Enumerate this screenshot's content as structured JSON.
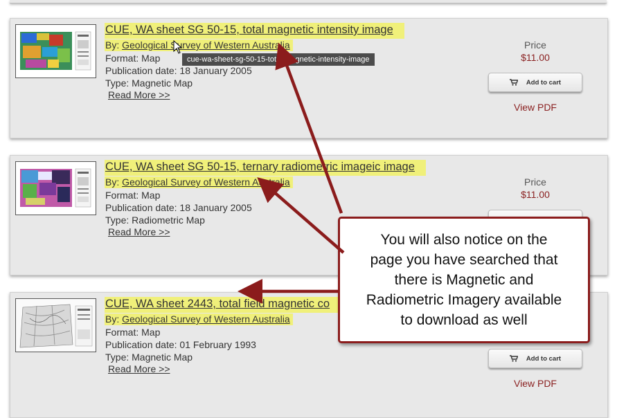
{
  "products": [
    {
      "title": "CUE, WA sheet SG 50-15, total magnetic intensity image",
      "by_label": "By:",
      "publisher": "Geological Survey of Western Australia",
      "format_label": "Format:",
      "format": "Map",
      "date_label": "Publication date:",
      "date": "18 January 2005",
      "type_label": "Type:",
      "type": "Magnetic Map",
      "read_more": "Read More >>",
      "price_label": "Price",
      "price": "$11.00",
      "cart_label": "Add to cart",
      "view_pdf": "View PDF"
    },
    {
      "title": "CUE, WA sheet SG 50-15, ternary radiometric imageic image",
      "by_label": "By:",
      "publisher": "Geological Survey of Western Australia",
      "format_label": "Format:",
      "format": "Map",
      "date_label": "Publication date:",
      "date": "18 January 2005",
      "type_label": "Type:",
      "type": "Radiometric Map",
      "read_more": "Read More >>",
      "price_label": "Price",
      "price": "$11.00"
    },
    {
      "title": "CUE, WA sheet 2443, total field magnetic co",
      "by_label": "By:",
      "publisher": "Geological Survey of Western Australia",
      "format_label": "Format:",
      "format": "Map",
      "date_label": "Publication date:",
      "date": "01 February 1993",
      "type_label": "Type:",
      "type": "Magnetic Map",
      "read_more": "Read More >>",
      "cart_label": "Add to cart",
      "view_pdf": "View PDF"
    }
  ],
  "tooltip": "cue-wa-sheet-sg-50-15-total-magnetic-intensity-image",
  "callout_text": "You will also notice on the\npage you have searched that\nthere is Magnetic and\nRadiometric  Imagery available\nto download as well",
  "colors": {
    "highlight": "#f0f07a",
    "accent_red": "#8b2222",
    "arrow": "#8b1c1c"
  },
  "icons": {
    "cart": "shopping-cart-icon",
    "cursor": "mouse-pointer-icon"
  }
}
